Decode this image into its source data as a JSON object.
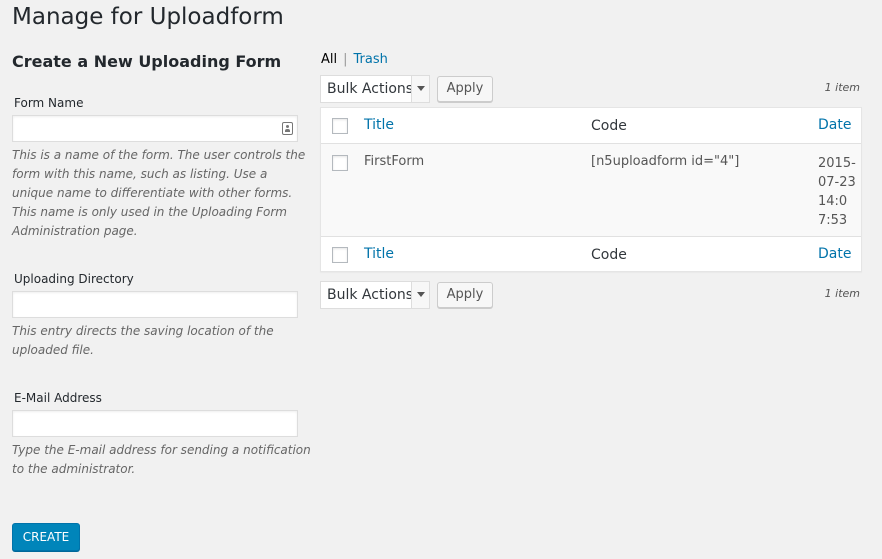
{
  "page": {
    "title": "Manage for Uploadform"
  },
  "create_form": {
    "heading": "Create a New Uploading Form",
    "fields": [
      {
        "label": "Form Name",
        "value": "",
        "description": "This is a name of the form. The user controls the form with this name, such as listing. Use a unique name to differentiate with other forms. This name is only used in the Uploading Form Administration page."
      },
      {
        "label": "Uploading Directory",
        "value": "",
        "description": "This entry directs the saving location of the uploaded file."
      },
      {
        "label": "E-Mail Address",
        "value": "",
        "description": "Type the E-mail address for sending a notification to the administrator."
      }
    ],
    "submit_label": "CREATE"
  },
  "filters": {
    "all_label": "All",
    "separator": "|",
    "trash_label": "Trash"
  },
  "tablenav": {
    "bulk_action_selected": "Bulk Actions",
    "apply_label": "Apply",
    "item_count": "1 item"
  },
  "table": {
    "columns": {
      "title": "Title",
      "code": "Code",
      "date": "Date"
    },
    "rows": [
      {
        "title": "FirstForm",
        "code": "[n5uploadform id=\"4\"]",
        "date": "2015-07-23 14:07:53"
      }
    ]
  },
  "colors": {
    "primary_button": "#0085ba",
    "link": "#0073aa",
    "background": "#f1f1f1"
  },
  "icons": {
    "contact_card": "contact-card-icon",
    "dropdown_arrow": "chevron-down-icon"
  }
}
